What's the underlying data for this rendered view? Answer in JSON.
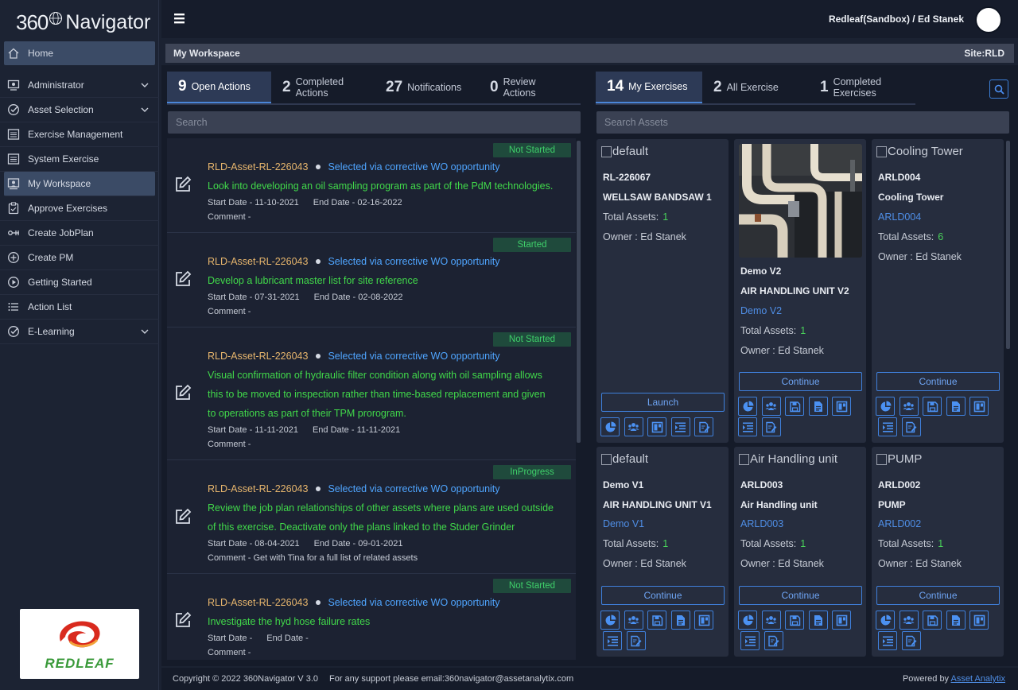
{
  "app": {
    "logo_num": "360",
    "logo_name": "Navigator",
    "user": "Redleaf(Sandbox) / Ed Stanek"
  },
  "sidebar": {
    "items": [
      {
        "label": "Home",
        "icon": "home-icon"
      },
      {
        "label": "Administrator",
        "icon": "admin-icon"
      },
      {
        "label": "Asset Selection",
        "icon": "check-circle-icon"
      },
      {
        "label": "Exercise Management",
        "icon": "list-box-icon"
      },
      {
        "label": "System Exercise",
        "icon": "list-box-icon"
      },
      {
        "label": "My Workspace",
        "icon": "workspace-icon"
      },
      {
        "label": "Approve Exercises",
        "icon": "clipboard-icon"
      },
      {
        "label": "Create JobPlan",
        "icon": "jobplan-icon"
      },
      {
        "label": "Create PM",
        "icon": "plus-circle-icon"
      },
      {
        "label": "Getting Started",
        "icon": "play-circle-icon"
      },
      {
        "label": "Action List",
        "icon": "list-icon"
      },
      {
        "label": "E-Learning",
        "icon": "check-circle-icon"
      }
    ],
    "partner_logo_text": "REDLEAF"
  },
  "breadcrumb": {
    "title": "My Workspace",
    "site": "Site:RLD"
  },
  "left_tabs": [
    {
      "num": "9",
      "l1": "Open Actions",
      "l2": ""
    },
    {
      "num": "2",
      "l1": "Completed",
      "l2": "Actions"
    },
    {
      "num": "27",
      "l1": "Notifications",
      "l2": ""
    },
    {
      "num": "0",
      "l1": "Review",
      "l2": "Actions"
    }
  ],
  "right_tabs": [
    {
      "num": "14",
      "l1": "My Exercises",
      "l2": ""
    },
    {
      "num": "2",
      "l1": "All Exercise",
      "l2": ""
    },
    {
      "num": "1",
      "l1": "Completed",
      "l2": "Exercises"
    }
  ],
  "search": {
    "actions_placeholder": "Search",
    "assets_placeholder": "Search Assets"
  },
  "actions": [
    {
      "status": "Not Started",
      "asset": "RLD-Asset-RL-226043",
      "source": "Selected via corrective WO opportunity",
      "desc": [
        "Look into developing an oil sampling program as part of the PdM technologies."
      ],
      "start": "Start Date - 11-10-2021",
      "end": "End Date - 02-16-2022",
      "comment": "Comment -"
    },
    {
      "status": "Started",
      "asset": "RLD-Asset-RL-226043",
      "source": "Selected via corrective WO opportunity",
      "desc": [
        "Develop a lubricant master list for site reference"
      ],
      "start": "Start Date - 07-31-2021",
      "end": "End Date - 02-08-2022",
      "comment": "Comment -"
    },
    {
      "status": "Not Started",
      "asset": "RLD-Asset-RL-226043",
      "source": "Selected via corrective WO opportunity",
      "desc": [
        "Visual confirmation of hydraulic filter condition along with oil sampling allows",
        "this to be moved to inspection rather than time-based replacement and given",
        "to operations as part of their TPM prorogram."
      ],
      "start": "Start Date - 11-11-2021",
      "end": "End Date - 11-11-2021",
      "comment": "Comment -"
    },
    {
      "status": "InProgress",
      "asset": "RLD-Asset-RL-226043",
      "source": "Selected via corrective WO opportunity",
      "desc": [
        "Review the job plan relationships of other assets where plans are used outside",
        "of this exercise. Deactivate only the plans linked to the Studer Grinder"
      ],
      "start": "Start Date - 08-04-2021",
      "end": "End Date - 09-01-2021",
      "comment": "Comment - Get with Tina for a full list of related assets"
    },
    {
      "status": "Not Started",
      "asset": "RLD-Asset-RL-226043",
      "source": "Selected via corrective WO opportunity",
      "desc": [
        "Investigate the hyd hose failure rates"
      ],
      "start": "Start Date -",
      "end": "End Date -",
      "comment": "Comment -"
    }
  ],
  "exercises": [
    {
      "img_alt": "default",
      "t1": "RL-226067",
      "t2": "WELLSAW BANDSAW 1",
      "link": "",
      "total_label": "Total Assets:",
      "total": "1",
      "owner": "Owner : Ed Stanek",
      "button": "Launch"
    },
    {
      "img_alt": "",
      "t1": "Demo V2",
      "t2": "AIR HANDLING UNIT V2",
      "link": "Demo V2",
      "total_label": "Total Assets:",
      "total": "1",
      "owner": "Owner : Ed Stanek",
      "button": "Continue"
    },
    {
      "img_alt": "Cooling Tower",
      "t1": "ARLD004",
      "t2": "Cooling Tower",
      "link": "ARLD004",
      "total_label": "Total Assets:",
      "total": "6",
      "owner": "Owner : Ed Stanek",
      "button": "Continue"
    },
    {
      "img_alt": "default",
      "t1": "Demo V1",
      "t2": "AIR HANDLING UNIT V1",
      "link": "Demo V1",
      "total_label": "Total Assets:",
      "total": "1",
      "owner": "Owner : Ed Stanek",
      "button": "Continue"
    },
    {
      "img_alt": "Air Handling unit",
      "t1": "ARLD003",
      "t2": "Air Handling unit",
      "link": "ARLD003",
      "total_label": "Total Assets:",
      "total": "1",
      "owner": "Owner : Ed Stanek",
      "button": "Continue"
    },
    {
      "img_alt": "PUMP",
      "t1": "ARLD002",
      "t2": "PUMP",
      "link": "ARLD002",
      "total_label": "Total Assets:",
      "total": "1",
      "owner": "Owner : Ed Stanek",
      "button": "Continue"
    }
  ],
  "footer": {
    "copyright": "Copyright © 2022 360Navigator V 3.0",
    "support": "For any support please email:360navigator@assetanalytix.com",
    "powered": "Powered by",
    "powered_link": "Asset Analytix"
  },
  "colors": {
    "accent": "#4a86d9",
    "status_green": "#3fd06a",
    "desc_green": "#41d94a",
    "asset_orange": "#e7b66d",
    "link_blue": "#4fa5ff"
  }
}
